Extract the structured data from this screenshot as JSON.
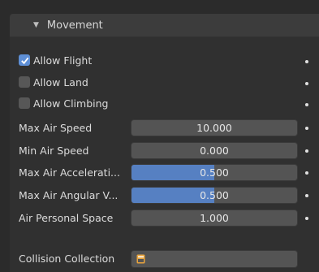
{
  "panel": {
    "title": "Movement"
  },
  "checkboxes": [
    {
      "label": "Allow Flight",
      "checked": true
    },
    {
      "label": "Allow Land",
      "checked": false
    },
    {
      "label": "Allow Climbing",
      "checked": false
    }
  ],
  "fields": [
    {
      "label": "Max Air Speed",
      "value": "10.000",
      "fill": 0
    },
    {
      "label": "Min Air Speed",
      "value": "0.000",
      "fill": 0
    },
    {
      "label": "Max Air Accelerati...",
      "value": "0.500",
      "fill": 0.5
    },
    {
      "label": "Max Air Angular V...",
      "value": "0.500",
      "fill": 0.5
    },
    {
      "label": "Air Personal Space",
      "value": "1.000",
      "fill": 0
    }
  ],
  "collection": {
    "label": "Collision Collection",
    "icon": "collection-icon",
    "value": ""
  },
  "colors": {
    "accent": "#5680c2",
    "checkbox_on": "#5e8fd6",
    "collection_icon": "#e8a33d"
  }
}
